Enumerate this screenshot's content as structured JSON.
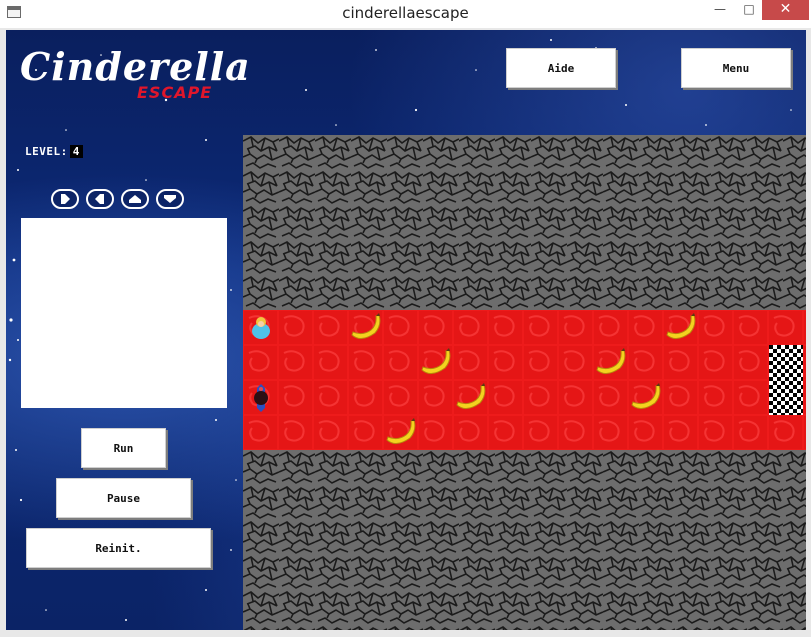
{
  "window": {
    "title": "cinderellaescape",
    "minimize_glyph": "—",
    "maximize_glyph": "□",
    "close_glyph": "✕"
  },
  "logo": {
    "main": "Cinderella",
    "sub": "ESCAPE"
  },
  "header": {
    "aide_label": "Aide",
    "menu_label": "Menu"
  },
  "level": {
    "label": "LEVEL:",
    "value": "4"
  },
  "commands": [
    {
      "name": "right",
      "icon": "arrow-right-icon"
    },
    {
      "name": "left",
      "icon": "arrow-left-icon"
    },
    {
      "name": "up",
      "icon": "arrow-up-icon"
    },
    {
      "name": "down",
      "icon": "arrow-down-icon"
    }
  ],
  "controls": {
    "run_label": "Run",
    "pause_label": "Pause",
    "reinit_label": "Reinit."
  },
  "board": {
    "columns": 16,
    "lanes": 4,
    "tile_colors": {
      "rock": "#6d6d6d",
      "road": "#ee1b1b"
    },
    "bananas": [
      {
        "col": 3,
        "lane": 0
      },
      {
        "col": 12,
        "lane": 0
      },
      {
        "col": 5,
        "lane": 1
      },
      {
        "col": 10,
        "lane": 1
      },
      {
        "col": 6,
        "lane": 2
      },
      {
        "col": 11,
        "lane": 2
      },
      {
        "col": 4,
        "lane": 3
      }
    ],
    "player_lane": 0,
    "enemy_lane": 2,
    "finish_lanes": [
      1,
      2
    ]
  }
}
